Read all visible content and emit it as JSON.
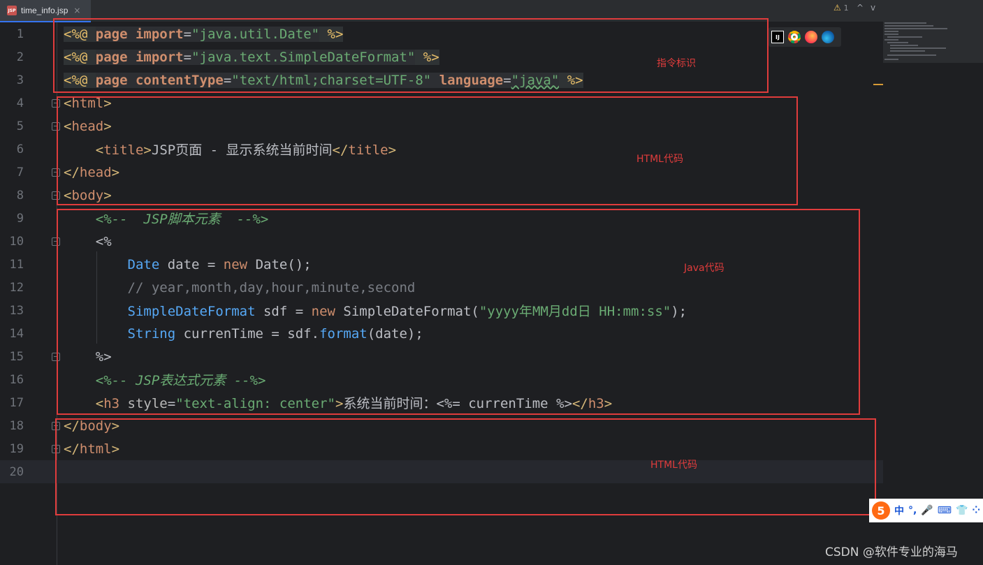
{
  "tab": {
    "filename": "time_info.jsp",
    "icon": "jsp-file-icon",
    "close": "×"
  },
  "inspections": {
    "warning_count": "1",
    "up": "^",
    "down": "v"
  },
  "browsers": [
    "intellij-icon",
    "chrome-icon",
    "firefox-icon",
    "edge-icon"
  ],
  "line_numbers": [
    "1",
    "2",
    "3",
    "4",
    "5",
    "6",
    "7",
    "8",
    "9",
    "10",
    "11",
    "12",
    "13",
    "14",
    "15",
    "16",
    "17",
    "18",
    "19",
    "20"
  ],
  "code": {
    "l1": {
      "a": "<%@ ",
      "b": "page ",
      "c": "import",
      "d": "=",
      "e": "\"java.util.Date\"",
      "f": " %>"
    },
    "l2": {
      "a": "<%@ ",
      "b": "page ",
      "c": "import",
      "d": "=",
      "e": "\"java.text.SimpleDateFormat\"",
      "f": " %>"
    },
    "l3": {
      "a": "<%@ ",
      "b": "page ",
      "c": "contentType",
      "d": "=",
      "e": "\"text/html;charset=UTF-8\"",
      "g": " language",
      "h": "=",
      "i": "\"java\"",
      "f": " %>"
    },
    "l4": {
      "a": "<",
      "b": "html",
      "c": ">"
    },
    "l5": {
      "a": "<",
      "b": "head",
      "c": ">"
    },
    "l6": {
      "indent": "    ",
      "a": "<",
      "b": "title",
      "c": ">",
      "d": "JSP页面 - 显示系统当前时间",
      "e": "</",
      "f": "title",
      "g": ">"
    },
    "l7": {
      "a": "</",
      "b": "head",
      "c": ">"
    },
    "l8": {
      "a": "<",
      "b": "body",
      "c": ">"
    },
    "l9": {
      "indent": "    ",
      "a": "<%--  JSP脚本元素  --%>"
    },
    "l10": {
      "indent": "    ",
      "a": "<%"
    },
    "l11": {
      "indent": "        ",
      "a": "Date",
      "b": " date = ",
      "c": "new",
      "d": " Date();"
    },
    "l12": {
      "indent": "        ",
      "a": "// year,month,day,hour,minute,second"
    },
    "l13": {
      "indent": "        ",
      "a": "SimpleDateFormat",
      "b": " sdf = ",
      "c": "new",
      "d": " SimpleDateFormat(",
      "e": "\"yyyy年MM月dd日 HH:mm:ss\"",
      "f": ");"
    },
    "l14": {
      "indent": "        ",
      "a": "String",
      "b": " currenTime = sdf.",
      "c": "format",
      "d": "(date);"
    },
    "l15": {
      "indent": "    ",
      "a": "%>"
    },
    "l16": {
      "indent": "    ",
      "a": "<%-- JSP表达式元素 --%>"
    },
    "l17": {
      "indent": "    ",
      "a": "<",
      "b": "h3",
      "c": " style",
      "d": "=",
      "e": "\"text-align: center\"",
      "f": ">",
      "g": "系统当前时间：",
      "h": "<%=",
      "i": " currenTime ",
      "j": "%>",
      "k": "</",
      "l": "h3",
      "m": ">"
    },
    "l18": {
      "a": "</",
      "b": "body",
      "c": ">"
    },
    "l19": {
      "a": "</",
      "b": "html",
      "c": ">"
    },
    "l20": {
      "a": ""
    }
  },
  "annotations": {
    "directive": "指令标识",
    "html_top": "HTML代码",
    "java": "Java代码",
    "html_bottom": "HTML代码"
  },
  "ime": {
    "logo": "5",
    "items": [
      "中",
      "°,",
      "🎤",
      "⌨",
      "👕",
      "⁘"
    ]
  },
  "watermark": "CSDN @软件专业的海马",
  "colors": {
    "annotation_red": "#e03c3c",
    "background": "#1e1f22",
    "accent": "#3574f0"
  }
}
